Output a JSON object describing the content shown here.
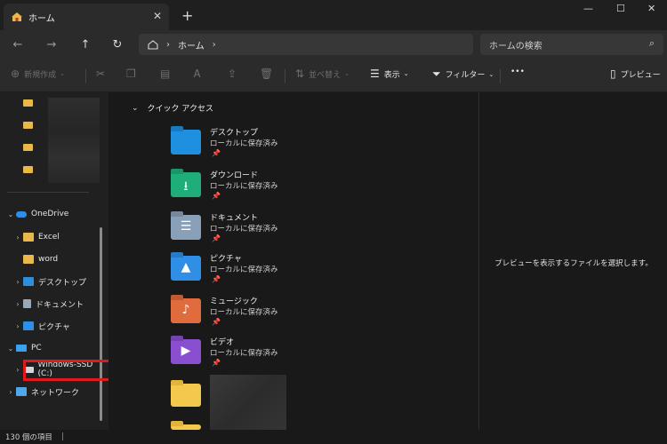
{
  "window": {
    "tab_title": "ホーム",
    "tab_close": "✕",
    "new_tab": "+",
    "minimize": "—",
    "maximize": "☐",
    "close": "✕"
  },
  "nav": {
    "back": "←",
    "forward": "→",
    "up": "↑",
    "refresh": "↻",
    "address_home_icon": "home-icon",
    "address_crumb": "ホーム",
    "search_placeholder": "ホームの検索"
  },
  "toolbar": {
    "new_label": "新規作成",
    "sort_label": "並べ替え",
    "view_label": "表示",
    "filter_label": "フィルター",
    "more_label": "•••",
    "preview_label": "プレビュー"
  },
  "sidebar": {
    "onedrive": "OneDrive",
    "items": [
      {
        "label": "Excel",
        "icon": "folder-icon"
      },
      {
        "label": "word",
        "icon": "folder-icon"
      },
      {
        "label": "デスクトップ",
        "icon": "desktop-folder-icon"
      },
      {
        "label": "ドキュメント",
        "icon": "documents-folder-icon"
      },
      {
        "label": "ピクチャ",
        "icon": "pictures-folder-icon"
      }
    ],
    "pc": "PC",
    "drive": "Windows-SSD (C:)",
    "network": "ネットワーク"
  },
  "main": {
    "section_title": "クイック アクセス",
    "quick_access": [
      {
        "name": "デスクトップ",
        "sub": "ローカルに保存済み",
        "color": "#1f8fe0",
        "icon": "desktop-folder-icon"
      },
      {
        "name": "ダウンロード",
        "sub": "ローカルに保存済み",
        "color": "#1fae7a",
        "icon": "downloads-folder-icon"
      },
      {
        "name": "ドキュメント",
        "sub": "ローカルに保存済み",
        "color": "#8aa0b8",
        "icon": "documents-folder-icon"
      },
      {
        "name": "ピクチャ",
        "sub": "ローカルに保存済み",
        "color": "#2f8fe6",
        "icon": "pictures-folder-icon"
      },
      {
        "name": "ミュージック",
        "sub": "ローカルに保存済み",
        "color": "#e06b3c",
        "icon": "music-folder-icon"
      },
      {
        "name": "ビデオ",
        "sub": "ローカルに保存済み",
        "color": "#8a4fd0",
        "icon": "videos-folder-icon"
      }
    ]
  },
  "preview": {
    "message": "プレビューを表示するファイルを選択します。"
  },
  "status": {
    "item_count": "130 個の項目",
    "separator": "|"
  },
  "colors": {
    "highlight": "#e01a1a",
    "folder": "#f2c94c",
    "onedrive": "#2f8fe6"
  }
}
